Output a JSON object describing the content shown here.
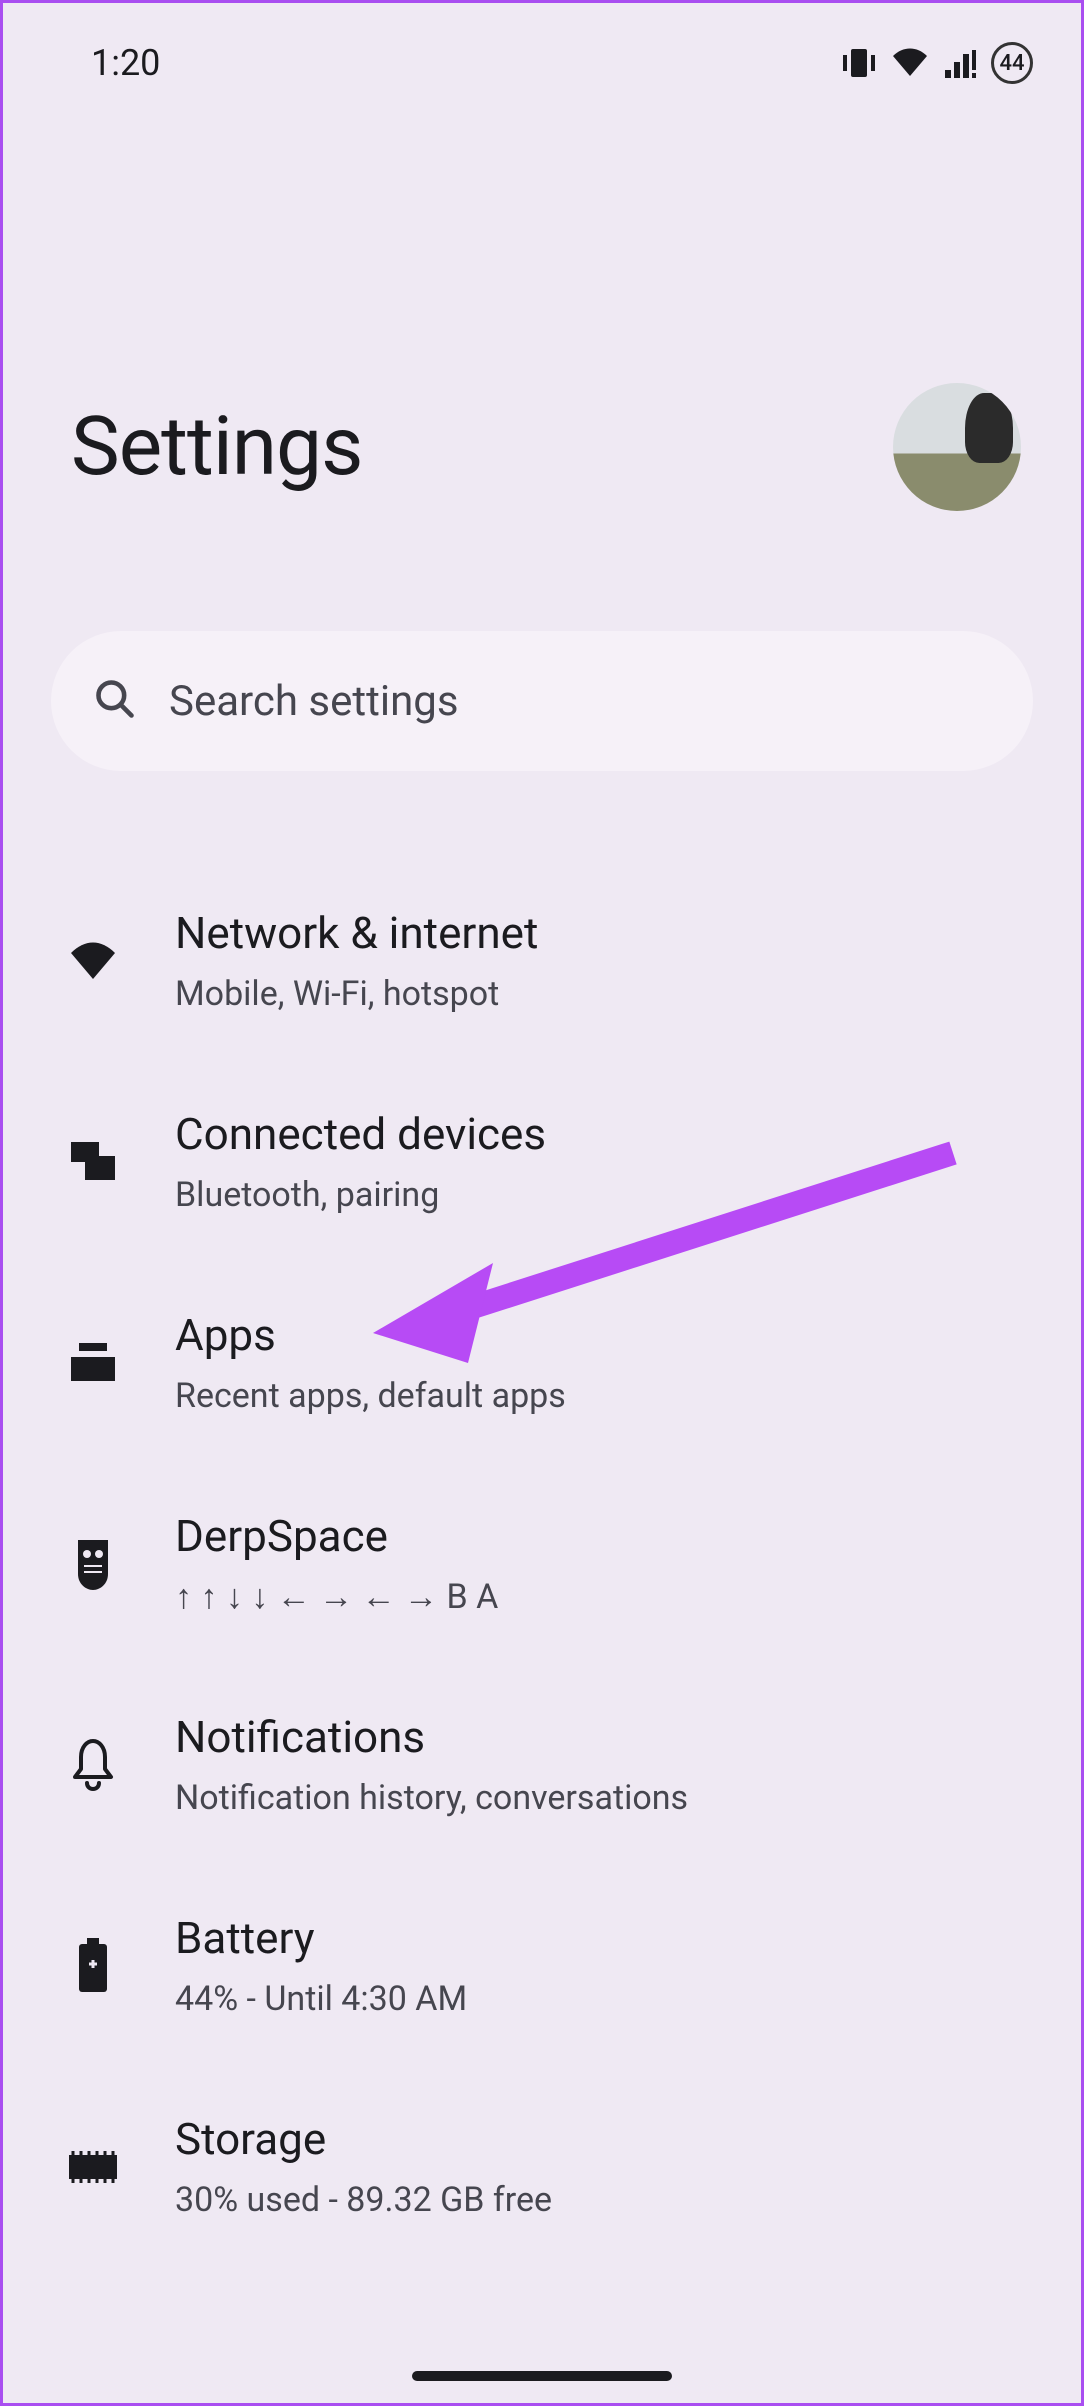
{
  "status": {
    "time": "1:20",
    "battery_level": "44"
  },
  "header": {
    "title": "Settings"
  },
  "search": {
    "placeholder": "Search settings"
  },
  "items": [
    {
      "title": "Network & internet",
      "subtitle": "Mobile, Wi-Fi, hotspot"
    },
    {
      "title": "Connected devices",
      "subtitle": "Bluetooth, pairing"
    },
    {
      "title": "Apps",
      "subtitle": "Recent apps, default apps"
    },
    {
      "title": "DerpSpace",
      "subtitle": "↑ ↑ ↓ ↓ ← → ← → B A"
    },
    {
      "title": "Notifications",
      "subtitle": "Notification history, conversations"
    },
    {
      "title": "Battery",
      "subtitle": "44% - Until 4:30 AM"
    },
    {
      "title": "Storage",
      "subtitle": "30% used - 89.32 GB free"
    }
  ],
  "annotation": {
    "arrow_color": "#b74bf5"
  }
}
